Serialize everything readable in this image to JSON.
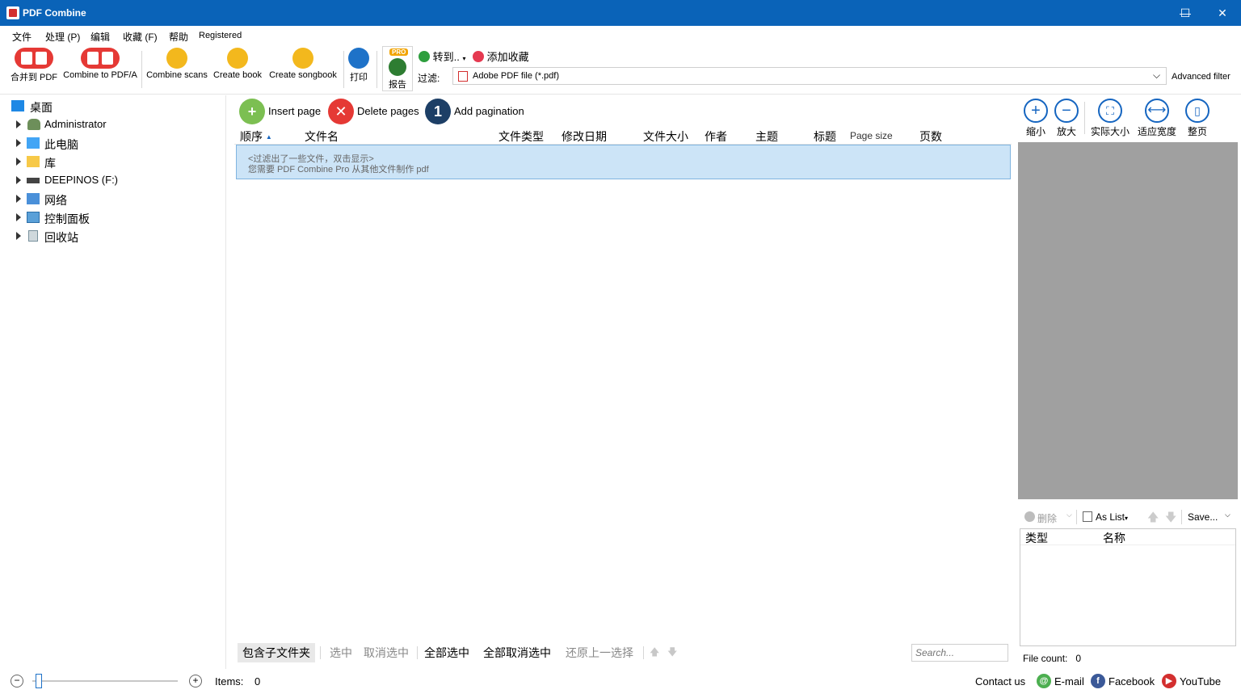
{
  "window": {
    "title": "PDF Combine",
    "minimize": "—",
    "maximize": "☐",
    "close": "✕"
  },
  "menu": [
    "文件",
    "处理 (P)",
    "编辑",
    "收藏 (F)",
    "帮助",
    "Registered"
  ],
  "toolbar": {
    "merge_pdf": "合并到 PDF",
    "combine_pdfa": "Combine to PDF/A",
    "combine_scans": "Combine scans",
    "create_book": "Create book",
    "create_songbook": "Create songbook",
    "print": "打印",
    "report": "报告",
    "pro_badge": "PRO",
    "goto": "转到..",
    "add_favorite": "添加收藏",
    "filter_label": "过滤:",
    "filter_value": "Adobe PDF file (*.pdf)",
    "advanced_filter": "Advanced filter"
  },
  "tree": [
    {
      "label": "桌面",
      "icon": "desktop-icon"
    },
    {
      "label": "Administrator",
      "icon": "user-icon"
    },
    {
      "label": "此电脑",
      "icon": "computer-icon"
    },
    {
      "label": "库",
      "icon": "library-icon"
    },
    {
      "label": "DEEPINOS (F:)",
      "icon": "drive-icon"
    },
    {
      "label": "网络",
      "icon": "network-icon"
    },
    {
      "label": "控制面板",
      "icon": "control-panel-icon"
    },
    {
      "label": "回收站",
      "icon": "recycle-bin-icon"
    }
  ],
  "actions": {
    "insert_page": "Insert page",
    "delete_pages": "Delete pages",
    "add_pagination": "Add pagination",
    "pagination_number": "1"
  },
  "columns": [
    "顺序",
    "文件名",
    "文件类型",
    "修改日期",
    "文件大小",
    "作者",
    "主题",
    "标题",
    "Page size",
    "页数"
  ],
  "filter_message": {
    "line1": "<过滤出了一些文件，双击显示>",
    "line2": "您需要 PDF Combine Pro 从其他文件制作 pdf"
  },
  "bottom_bar": {
    "include_subfolders": "包含子文件夹",
    "select": "选中",
    "deselect": "取消选中",
    "select_all": "全部选中",
    "deselect_all": "全部取消选中",
    "restore_selection": "还原上一选择",
    "search_placeholder": "Search..."
  },
  "zoom": {
    "zoom_out": "缩小",
    "zoom_in": "放大",
    "actual_size": "实际大小",
    "fit_width": "适应宽度",
    "whole_page": "整页"
  },
  "rtoolbar": {
    "delete": "删除",
    "as_list": "As List",
    "save": "Save..."
  },
  "rlist_columns": {
    "type": "类型",
    "name": "名称"
  },
  "status": {
    "items_label": "Items:",
    "items_value": "0",
    "file_count_label": "File count:",
    "file_count_value": "0",
    "contact": "Contact us",
    "email": "E-mail",
    "facebook": "Facebook",
    "youtube": "YouTube"
  },
  "colors": {
    "titlebar": "#0a63b8",
    "accent_blue": "#1565c0",
    "selection": "#cce4f7",
    "preview_bg": "#a0a0a0"
  }
}
